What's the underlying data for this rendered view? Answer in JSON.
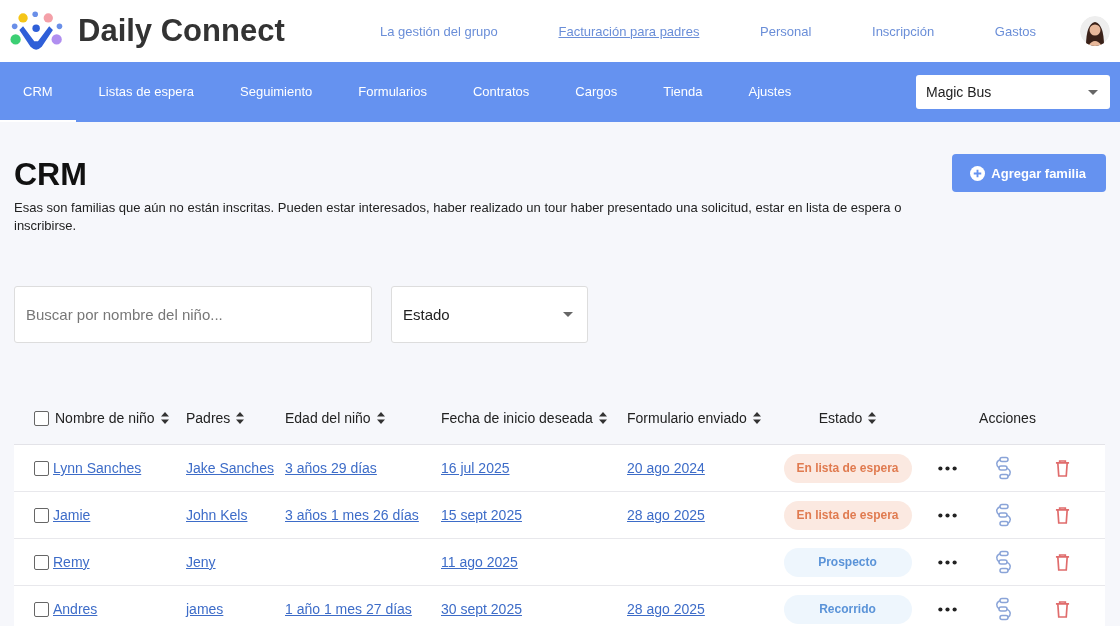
{
  "brand": {
    "name": "Daily Connect"
  },
  "top_nav": [
    {
      "label": "La gestión del grupo",
      "selected": false
    },
    {
      "label": "Facturación para padres",
      "selected": true
    },
    {
      "label": "Personal",
      "selected": false
    },
    {
      "label": "Inscripción",
      "selected": false
    },
    {
      "label": "Gastos",
      "selected": false
    }
  ],
  "tabs": [
    {
      "label": "CRM",
      "selected": true
    },
    {
      "label": "Listas de espera",
      "selected": false
    },
    {
      "label": "Seguimiento",
      "selected": false
    },
    {
      "label": "Formularios",
      "selected": false
    },
    {
      "label": "Contratos",
      "selected": false
    },
    {
      "label": "Cargos",
      "selected": false
    },
    {
      "label": "Tienda",
      "selected": false
    },
    {
      "label": "Ajustes",
      "selected": false
    }
  ],
  "school_select": {
    "value": "Magic Bus"
  },
  "page": {
    "title": "CRM",
    "description": "Esas son familias que aún no están inscritas. Pueden estar interesados, haber realizado un tour haber presentado una solicitud, estar en lista de espera o inscribirse.",
    "add_button": "Agregar familia"
  },
  "filters": {
    "search": {
      "placeholder": "Buscar por nombre del niño..."
    },
    "status": {
      "value": "Estado"
    }
  },
  "table": {
    "select_all": {
      "checked": false
    },
    "columns": [
      {
        "label": "Nombre de niño",
        "sortable": true
      },
      {
        "label": "Padres",
        "sortable": true
      },
      {
        "label": "Edad del niño",
        "sortable": true
      },
      {
        "label": "Fecha de inicio deseada",
        "sortable": true
      },
      {
        "label": "Formulario enviado",
        "sortable": true
      },
      {
        "label": "Estado",
        "sortable": true
      },
      {
        "label": "Acciones",
        "sortable": false
      }
    ],
    "rows": [
      {
        "checked": false,
        "child": "Lynn Sanches",
        "parents": "Jake Sanches",
        "age": "3 años 29 días",
        "start_date": "16 jul 2025",
        "form_sent": "20 ago 2024",
        "status": {
          "label": "En lista de espera",
          "kind": "waitlist"
        }
      },
      {
        "checked": false,
        "child": "Jamie",
        "parents": "John Kels",
        "age": "3 años 1 mes 26 días",
        "start_date": "15 sept 2025",
        "form_sent": "28 ago 2025",
        "status": {
          "label": "En lista de espera",
          "kind": "waitlist"
        }
      },
      {
        "checked": false,
        "child": "Remy",
        "parents": "Jeny",
        "start_date": "11 ago 2025",
        "status": {
          "label": "Prospecto",
          "kind": "prospect"
        }
      },
      {
        "checked": false,
        "child": "Andres",
        "parents": "james",
        "age": "1 año 1 mes 27 días",
        "start_date": "30 sept 2025",
        "form_sent": "28 ago 2025",
        "status": {
          "label": "Recorrido",
          "kind": "tour"
        }
      }
    ]
  }
}
